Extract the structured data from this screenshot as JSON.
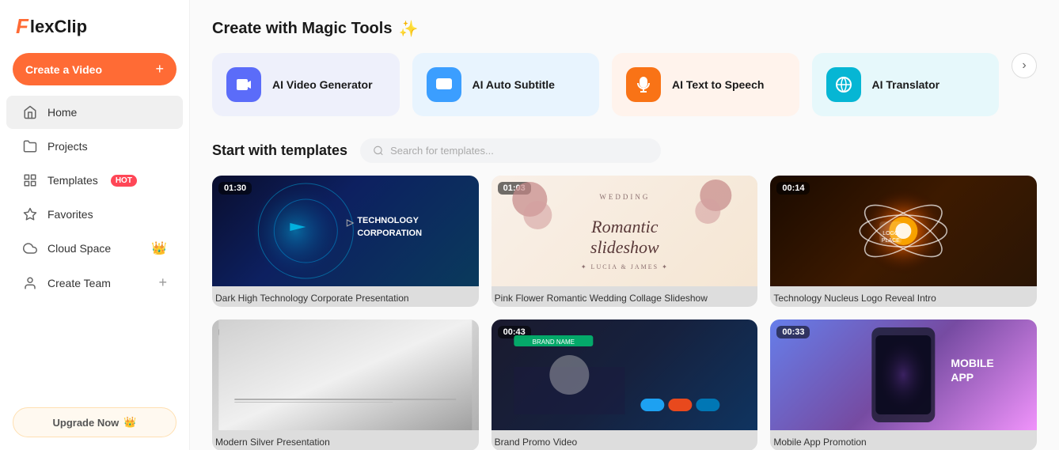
{
  "app": {
    "logo": "FlexClip"
  },
  "sidebar": {
    "create_video_label": "Create a Video",
    "nav_items": [
      {
        "id": "home",
        "label": "Home",
        "icon": "home",
        "active": true
      },
      {
        "id": "projects",
        "label": "Projects",
        "icon": "folder"
      },
      {
        "id": "templates",
        "label": "Templates",
        "icon": "grid",
        "badge": "HOT"
      },
      {
        "id": "favorites",
        "label": "Favorites",
        "icon": "star"
      },
      {
        "id": "cloud-space",
        "label": "Cloud Space",
        "icon": "cloud",
        "crown": true
      },
      {
        "id": "create-team",
        "label": "Create Team",
        "icon": "person",
        "plus": true
      }
    ],
    "upgrade_label": "Upgrade Now"
  },
  "magic_tools": {
    "section_title": "Create with Magic Tools",
    "title_emoji": "✨",
    "tools": [
      {
        "id": "ai-video-gen",
        "label": "AI Video Generator",
        "color": "purple",
        "icon": "🤖"
      },
      {
        "id": "ai-auto-subtitle",
        "label": "AI Auto Subtitle",
        "color": "blue",
        "icon": "💬"
      },
      {
        "id": "ai-text-to-speech",
        "label": "AI Text to Speech",
        "color": "orange",
        "icon": "🔊"
      },
      {
        "id": "ai-translator",
        "label": "AI Translator",
        "color": "cyan",
        "icon": "🌐"
      }
    ],
    "scroll_next": "›"
  },
  "templates": {
    "section_title": "Start with templates",
    "search_placeholder": "Search for templates...",
    "cards": [
      {
        "id": "tech-corp",
        "duration": "01:30",
        "title": "Dark High Technology Corporate Presentation",
        "thumb_type": "tech"
      },
      {
        "id": "wedding",
        "duration": "01:03",
        "title": "Pink Flower Romantic Wedding Collage Slideshow",
        "thumb_type": "wedding"
      },
      {
        "id": "nucleus",
        "duration": "00:14",
        "title": "Technology Nucleus Logo Reveal Intro",
        "thumb_type": "nucleus"
      },
      {
        "id": "silver",
        "duration": "00:37",
        "title": "Modern Silver Presentation",
        "thumb_type": "silver"
      },
      {
        "id": "brand",
        "duration": "00:43",
        "title": "Brand Promo Video",
        "thumb_type": "brand"
      },
      {
        "id": "phone",
        "duration": "00:33",
        "title": "Mobile App Promotion",
        "thumb_type": "phone"
      }
    ]
  }
}
